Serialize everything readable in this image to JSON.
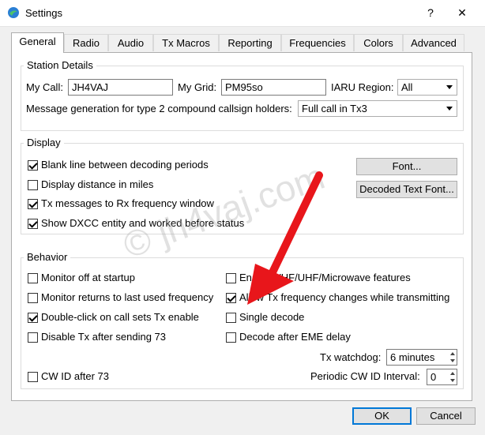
{
  "window": {
    "title": "Settings",
    "help_label": "?",
    "close_label": "✕"
  },
  "tabs": [
    "General",
    "Radio",
    "Audio",
    "Tx Macros",
    "Reporting",
    "Frequencies",
    "Colors",
    "Advanced"
  ],
  "station": {
    "title": "Station Details",
    "my_call_label": "My Call:",
    "my_call_value": "JH4VAJ",
    "my_grid_label": "My Grid:",
    "my_grid_value": "PM95so",
    "iaru_label": "IARU Region:",
    "iaru_value": "All",
    "msg_gen_label": "Message generation for type 2 compound callsign holders:",
    "msg_gen_value": "Full call in Tx3"
  },
  "display": {
    "title": "Display",
    "options": [
      {
        "label": "Blank line between decoding periods",
        "checked": true
      },
      {
        "label": "Display distance in miles",
        "checked": false
      },
      {
        "label": "Tx messages to Rx frequency window",
        "checked": true
      },
      {
        "label": "Show DXCC entity and worked before status",
        "checked": true
      }
    ],
    "font_button": "Font...",
    "decoded_font_button": "Decoded Text Font..."
  },
  "behavior": {
    "title": "Behavior",
    "left_options": [
      {
        "label": "Monitor off at startup",
        "checked": false
      },
      {
        "label": "Monitor returns to last used frequency",
        "checked": false
      },
      {
        "label": "Double-click on call sets Tx enable",
        "checked": true
      },
      {
        "label": "Disable Tx after sending 73",
        "checked": false
      }
    ],
    "right_options": [
      {
        "label": "Enable VHF/UHF/Microwave features",
        "checked": false
      },
      {
        "label": "Allow Tx frequency changes while transmitting",
        "checked": true
      },
      {
        "label": "Single decode",
        "checked": false
      },
      {
        "label": "Decode after EME delay",
        "checked": false
      }
    ],
    "tx_watchdog_label": "Tx watchdog:",
    "tx_watchdog_value": "6 minutes",
    "cw_id_label": "CW ID after 73",
    "cw_id_checked": false,
    "periodic_cw_label": "Periodic CW ID Interval:",
    "periodic_cw_value": "0"
  },
  "footer": {
    "ok_label": "OK",
    "cancel_label": "Cancel"
  },
  "watermark": "© jh4vaj.com",
  "colors": {
    "arrow": "#e8161b",
    "accent": "#0078d7"
  }
}
